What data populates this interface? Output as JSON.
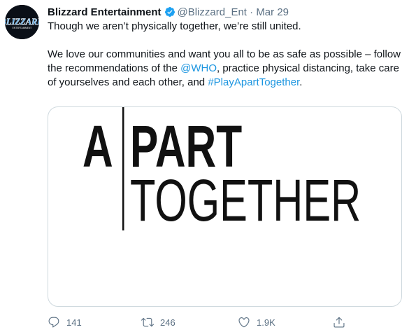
{
  "tweet": {
    "author": {
      "display_name": "Blizzard Entertainment",
      "handle": "@Blizzard_Ent",
      "verified": true,
      "avatar_logo_text": "BLIZZARD",
      "avatar_sub_text": "ENTERTAINMENT"
    },
    "separator": "·",
    "date": "Mar 29",
    "text": {
      "line1": "Though we aren’t physically together, we’re still united.",
      "para2_a": "We love our communities and want you all to be as safe as possible – follow the recommendations of the ",
      "mention_who": "@WHO",
      "para2_b": ", practice physical distancing, take care of yourselves and each other, and ",
      "hashtag": "#PlayApartTogether",
      "para2_end": "."
    },
    "media": {
      "word_a": "A",
      "word_part": "PART",
      "word_together": "TOGETHER"
    },
    "actions": {
      "reply_count": "141",
      "retweet_count": "246",
      "like_count": "1.9K"
    },
    "colors": {
      "link": "#1b95e0",
      "secondary_text": "#5b7083",
      "verified_badge": "#1da1f2",
      "avatar_bg": "#0a0f17"
    }
  }
}
